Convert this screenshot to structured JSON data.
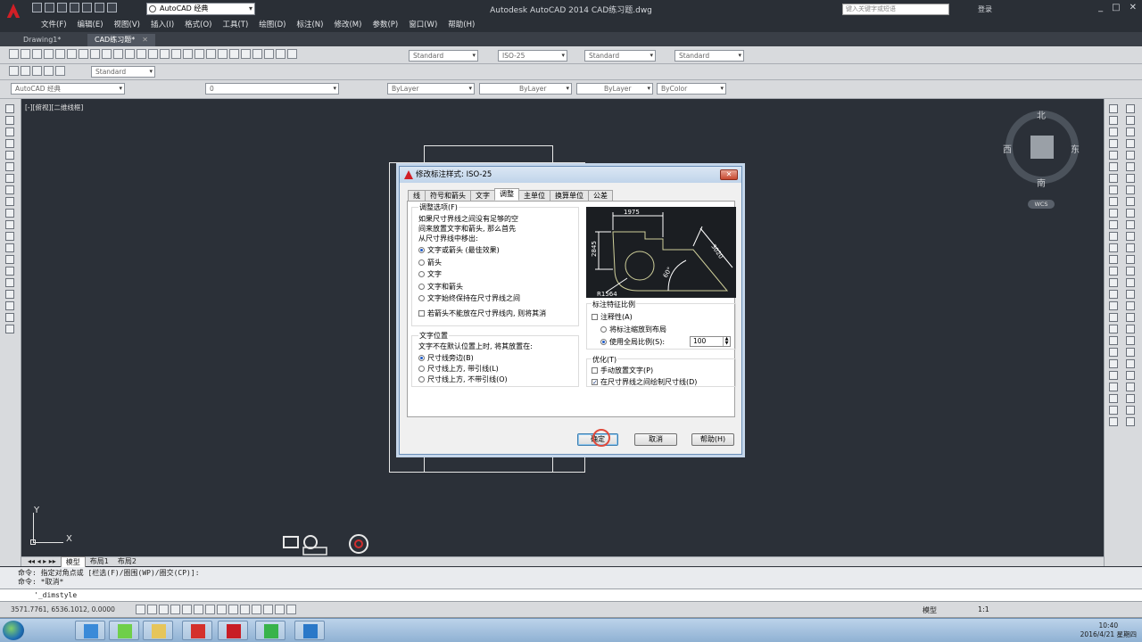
{
  "title_bar": {
    "workspace": "AutoCAD 经典",
    "app_title": "Autodesk AutoCAD 2014    CAD练习题.dwg",
    "search_placeholder": "键入关键字或短语",
    "login": "登录"
  },
  "menu": [
    "文件(F)",
    "编辑(E)",
    "视图(V)",
    "插入(I)",
    "格式(O)",
    "工具(T)",
    "绘图(D)",
    "标注(N)",
    "修改(M)",
    "参数(P)",
    "窗口(W)",
    "帮助(H)"
  ],
  "doc_tabs": [
    {
      "label": "Drawing1*",
      "active": false
    },
    {
      "label": "CAD练习题*",
      "active": true
    }
  ],
  "toolbar": {
    "text_style": "Standard",
    "dim_style": "ISO-25",
    "table_style": "Standard",
    "mleader_style": "Standard",
    "visual_style": "Standard",
    "workspace_combo": "AutoCAD 经典",
    "layer": "0",
    "color": "ByLayer",
    "linetype": "ByLayer",
    "lineweight": "ByLayer",
    "plotstyle": "ByColor"
  },
  "viewport": {
    "label": "[-][俯视][二维线框]",
    "compass": {
      "n": "北",
      "s": "南",
      "e": "东",
      "w": "西"
    },
    "wcs": "WCS",
    "ucs_x": "X",
    "ucs_y": "Y"
  },
  "layout_tabs": [
    "模型",
    "布局1",
    "布局2"
  ],
  "command": {
    "history_1": "命令: 指定对角点或 [栏选(F)/圈围(WP)/圈交(CP)]:",
    "history_2": "命令: *取消*",
    "current": "'_dimstyle"
  },
  "status": {
    "coords": "3571.7761, 6536.1012, 0.0000",
    "model": "模型",
    "scale": "1:1"
  },
  "clock": {
    "time": "10:40",
    "date": "2016/4/21 星期四"
  },
  "dialog": {
    "title": "修改标注样式: ISO-25",
    "tabs": [
      "线",
      "符号和箭头",
      "文字",
      "调整",
      "主单位",
      "换算单位",
      "公差"
    ],
    "active_tab": "调整",
    "fit_options": {
      "title": "调整选项(F)",
      "desc_1": "如果尺寸界线之间没有足够的空",
      "desc_2": "间来放置文字和箭头, 那么首先",
      "desc_3": "从尺寸界线中移出:",
      "options": [
        "文字或箭头 (最佳效果)",
        "箭头",
        "文字",
        "文字和箭头",
        "文字始终保持在尺寸界线之间"
      ],
      "selected": 0,
      "suppress": "若箭头不能放在尺寸界线内, 则将其消"
    },
    "text_placement": {
      "title": "文字位置",
      "desc": "文字不在默认位置上时, 将其放置在:",
      "options": [
        "尺寸线旁边(B)",
        "尺寸线上方, 带引线(L)",
        "尺寸线上方, 不带引线(O)"
      ],
      "selected": 0
    },
    "scale": {
      "title": "标注特征比例",
      "annotative": "注释性(A)",
      "scale_to_layout": "将标注缩放到布局",
      "overall": "使用全局比例(S):",
      "overall_value": "100",
      "selected": 1
    },
    "fine_tuning": {
      "title": "优化(T)",
      "manual": "手动放置文字(P)",
      "draw_dim": "在尺寸界线之间绘制尺寸线(D)",
      "draw_dim_checked": true
    },
    "preview": {
      "dim_top": "1975",
      "dim_left": "2845",
      "dim_diag": "3020",
      "angle": "60°",
      "radius": "R1564"
    },
    "buttons": {
      "ok": "确定",
      "cancel": "取消",
      "help": "帮助(H)"
    }
  }
}
